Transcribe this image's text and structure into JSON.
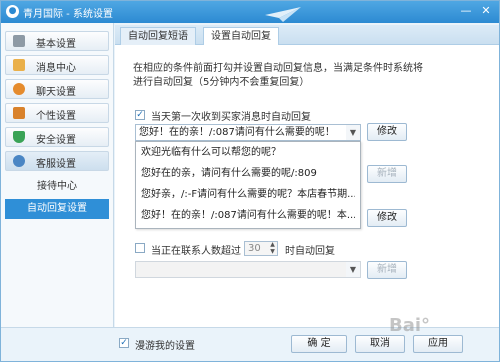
{
  "window": {
    "title": "青月国际 - 系统设置",
    "logo": "●"
  },
  "sidebar": {
    "items": [
      {
        "label": "基本设置",
        "icon": "wrench-icon",
        "color": "#7d8b97"
      },
      {
        "label": "消息中心",
        "icon": "envelope-icon",
        "color": "#e8a33a"
      },
      {
        "label": "聊天设置",
        "icon": "chat-icon",
        "color": "#e58b2d"
      },
      {
        "label": "个性设置",
        "icon": "person-icon",
        "color": "#d9822b"
      },
      {
        "label": "安全设置",
        "icon": "shield-icon",
        "color": "#3aa356"
      },
      {
        "label": "客服设置",
        "icon": "headset-icon",
        "color": "#4a86c4"
      }
    ],
    "sub_items": [
      "接待中心",
      "自动回复设置"
    ]
  },
  "tabs": [
    "自动回复短语",
    "设置自动回复"
  ],
  "content": {
    "description_line1": "在相应的条件前面打勾并设置自动回复信息，当满足条件时系统将",
    "description_line2": "进行自动回复（5分钟内不会重复回复）",
    "first_msg_label": "当天第一次收到买家消息时自动回复",
    "first_msg_checked": true,
    "first_msg_selected": "您好！在的亲！/:087请问有什么需要的呢！",
    "modify_label": "修改",
    "new_label": "新增",
    "dropdown_options": [
      "欢迎光临有什么可以帮您的呢？",
      "您好在的亲，请问有什么需要的呢/:809",
      "您好亲，/:-F请问有什么需要的呢？本店春节期...",
      "您好！在的亲！/:087请问有什么需要的呢！本..."
    ],
    "contacts_label_before": "当正在联系人数超过",
    "contacts_value": "30",
    "contacts_label_after": "时自动回复"
  },
  "footer": {
    "roam_label": "漫游我的设置",
    "roam_checked": true,
    "ok": "确 定",
    "cancel": "取消",
    "apply": "应用"
  },
  "watermark": "Bai°"
}
